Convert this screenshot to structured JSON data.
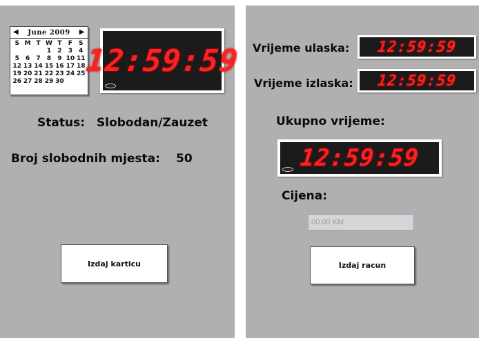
{
  "left": {
    "calendar": {
      "month_label": "June 2009",
      "prev_arrow": "◀",
      "next_arrow": "▶",
      "weekdays": [
        "S",
        "M",
        "T",
        "W",
        "T",
        "F",
        "S"
      ],
      "days": [
        "",
        "",
        "",
        "",
        "",
        "",
        "",
        "",
        "",
        "",
        "",
        "1",
        "2",
        "3",
        "4",
        "5",
        "6",
        "7",
        "8",
        "9",
        "10",
        "11"
      ],
      "rows": [
        [
          "",
          "",
          "",
          "",
          "",
          "",
          ""
        ],
        [
          "",
          "",
          "",
          "1",
          "2",
          "3",
          "4"
        ],
        [
          "5",
          "6",
          "7",
          "8",
          "9",
          "10",
          "11"
        ],
        [
          "12",
          "13",
          "14",
          "15",
          "16",
          "17",
          "18"
        ],
        [
          "19",
          "20",
          "21",
          "22",
          "23",
          "24",
          "25"
        ],
        [
          "26",
          "27",
          "28",
          "29",
          "30",
          "",
          ""
        ]
      ]
    },
    "clock": "12:59:59",
    "status_label": "Status:",
    "status_value": "Slobodan/Zauzet",
    "free_spots_label": "Broj slobodnih mjesta:",
    "free_spots_value": "50",
    "issue_card_button": "Izdaj karticu"
  },
  "right": {
    "entry_label": "Vrijeme ulaska:",
    "entry_clock": "12:59:59",
    "exit_label": "Vrijeme izlaska:",
    "exit_clock": "12:59:59",
    "total_label": "Ukupno vrijeme:",
    "total_clock": "12:59:59",
    "price_label": "Cijena:",
    "price_placeholder": "00.00 KM",
    "issue_bill_button": "Izdaj racun"
  },
  "colors": {
    "panel_bg": "#b0b0b0",
    "led_red": "#ff2020",
    "led_bg": "#1b1b1b"
  }
}
